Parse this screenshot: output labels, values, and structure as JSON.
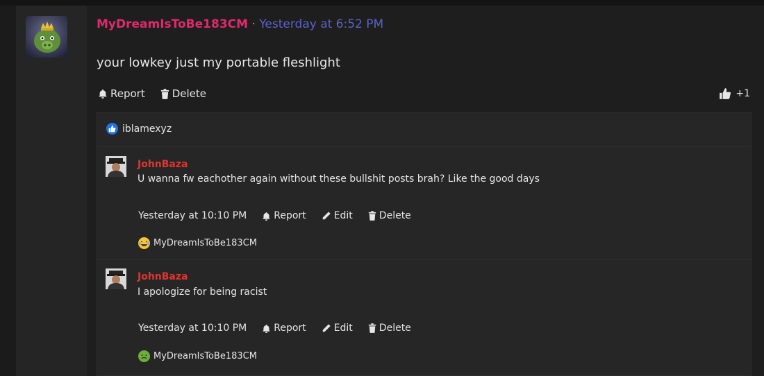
{
  "post": {
    "username": "MyDreamIsToBe183CM",
    "separator": "·",
    "timestamp": "Yesterday at 6:52 PM",
    "message": "your lowkey just my portable fleshlight",
    "actions": {
      "report": "Report",
      "delete": "Delete"
    },
    "like_count": "+1",
    "colors": {
      "username": "#e0286e",
      "timestamp": "#5b62c9"
    }
  },
  "likes": {
    "liker": "iblamexyz",
    "icon": "thumbs-up-icon"
  },
  "replies": [
    {
      "username": "JohnBaza",
      "text": "U wanna fw eachother again without these bullshit posts brah? Like the good days",
      "timestamp": "Yesterday at 10:10 PM",
      "report": "Report",
      "edit": "Edit",
      "delete": "Delete",
      "reaction_icon": "laughing-crying-emoji-icon",
      "reaction_user": "MyDreamIsToBe183CM"
    },
    {
      "username": "JohnBaza",
      "text": "I apologize for being racist",
      "timestamp": "Yesterday at 10:10 PM",
      "report": "Report",
      "edit": "Edit",
      "delete": "Delete",
      "reaction_icon": "nauseated-emoji-icon",
      "reaction_user": "MyDreamIsToBe183CM"
    }
  ]
}
